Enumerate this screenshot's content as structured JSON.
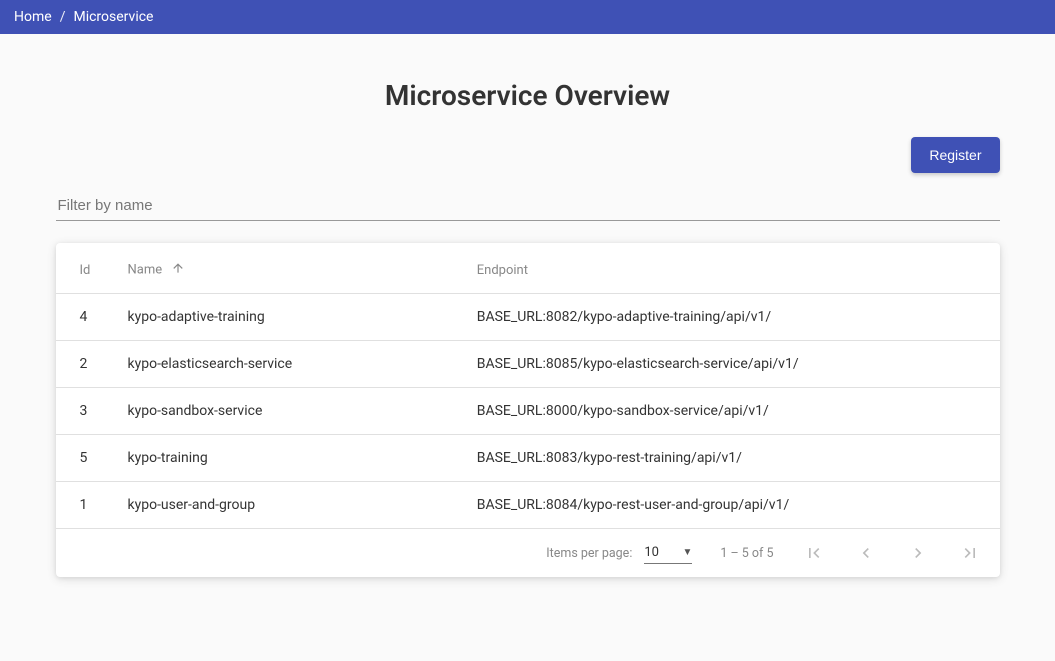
{
  "breadcrumb": {
    "home": "Home",
    "current": "Microservice"
  },
  "page": {
    "title": "Microservice Overview"
  },
  "actions": {
    "register": "Register"
  },
  "filter": {
    "placeholder": "Filter by name"
  },
  "table": {
    "columns": {
      "id": "Id",
      "name": "Name",
      "endpoint": "Endpoint"
    },
    "rows": [
      {
        "id": "4",
        "name": "kypo-adaptive-training",
        "endpoint": "BASE_URL:8082/kypo-adaptive-training/api/v1/"
      },
      {
        "id": "2",
        "name": "kypo-elasticsearch-service",
        "endpoint": "BASE_URL:8085/kypo-elasticsearch-service/api/v1/"
      },
      {
        "id": "3",
        "name": "kypo-sandbox-service",
        "endpoint": "BASE_URL:8000/kypo-sandbox-service/api/v1/"
      },
      {
        "id": "5",
        "name": "kypo-training",
        "endpoint": "BASE_URL:8083/kypo-rest-training/api/v1/"
      },
      {
        "id": "1",
        "name": "kypo-user-and-group",
        "endpoint": "BASE_URL:8084/kypo-rest-user-and-group/api/v1/"
      }
    ]
  },
  "paginator": {
    "items_per_page_label": "Items per page:",
    "page_size": "10",
    "range_label": "1 – 5 of 5"
  }
}
